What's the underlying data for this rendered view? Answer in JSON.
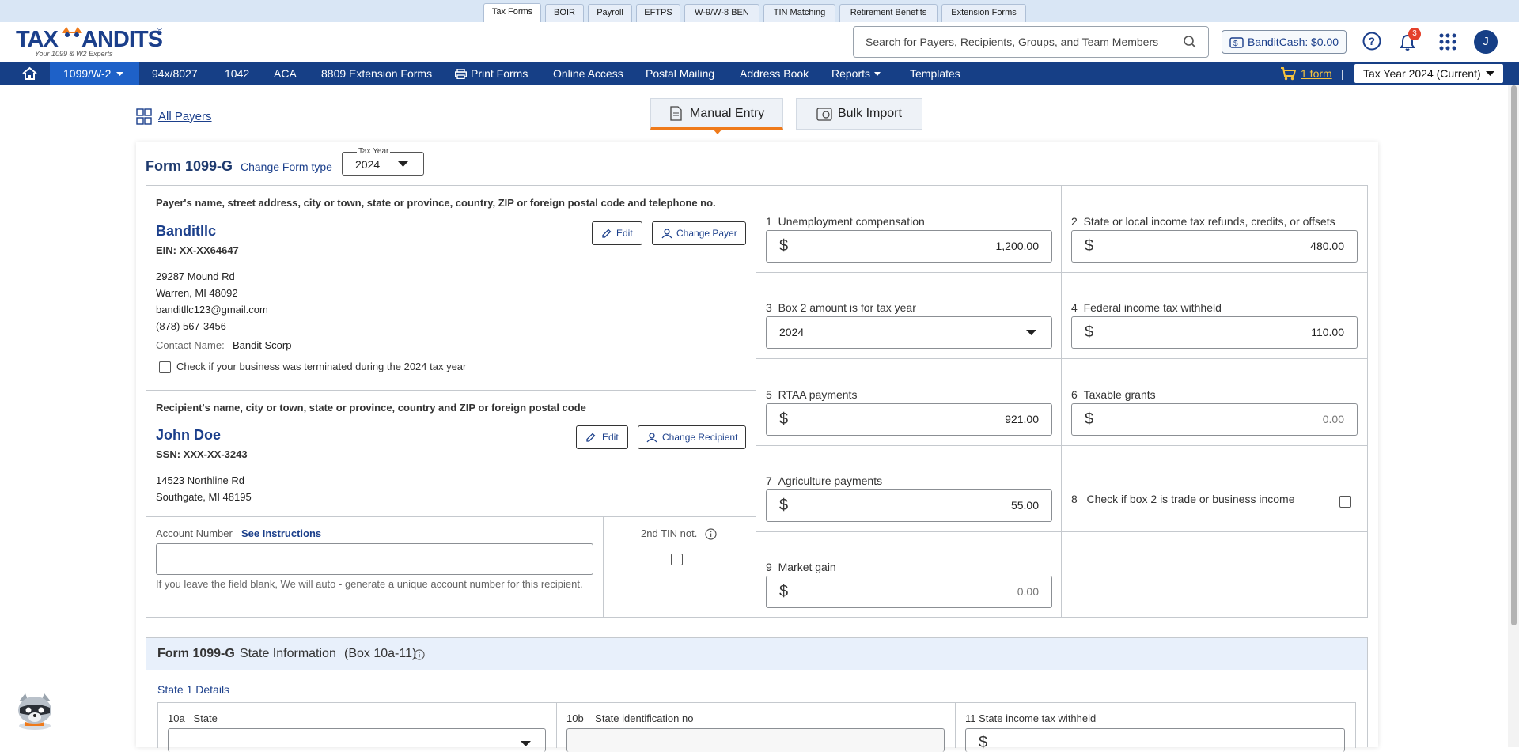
{
  "top_tabs": [
    "Tax Forms",
    "BOIR",
    "Payroll",
    "EFTPS",
    "W-9/W-8 BEN",
    "TIN Matching",
    "Retirement Benefits",
    "Extension Forms"
  ],
  "logo": {
    "main": "TAXBANDITS",
    "reg": "®",
    "tagline": "Your 1099 & W2 Experts"
  },
  "search": {
    "placeholder": "Search for Payers, Recipients, Groups, and Team Members"
  },
  "banditcash": {
    "label": "BanditCash:",
    "amount": "$0.00"
  },
  "notifications": {
    "count": "3"
  },
  "avatar": {
    "initial": "J"
  },
  "nav": {
    "items": [
      "1099/W-2",
      "94x/8027",
      "1042",
      "ACA",
      "8809 Extension Forms",
      "Print Forms",
      "Online Access",
      "Postal Mailing",
      "Address Book",
      "Reports",
      "Templates"
    ],
    "cart": "1 form",
    "divider": "|",
    "tax_year": "Tax Year 2024 (Current)"
  },
  "page": {
    "all_payers": "All Payers",
    "manual_entry": "Manual Entry",
    "bulk_import": "Bulk Import"
  },
  "form": {
    "title": "Form 1099-G",
    "change_type": "Change Form type",
    "tax_year_label": "Tax Year",
    "tax_year": "2024",
    "payer_heading": "Payer's name, street address, city or town, state or province, country, ZIP or foreign postal code and telephone no.",
    "payer": {
      "name": "Banditllc",
      "ein": "EIN: XX-XX64647",
      "street": "29287 Mound Rd",
      "city": "Warren, MI 48092",
      "email": "banditllc123@gmail.com",
      "phone": "(878) 567-3456",
      "contact_label": "Contact Name:",
      "contact": "Bandit Scorp",
      "terminated": "Check if your business was terminated during the 2024 tax year",
      "edit": "Edit",
      "change": "Change Payer"
    },
    "recipient_heading": "Recipient's name, city or town, state or province, country and ZIP or foreign postal code",
    "recipient": {
      "name": "John Doe",
      "ssn": "SSN: XXX-XX-3243",
      "street": "14523 Northline Rd",
      "city": "Southgate, MI 48195",
      "edit": "Edit",
      "change": "Change Recipient"
    },
    "account": {
      "label": "Account Number",
      "instructions": "See Instructions",
      "help": "If you leave the field blank, We will auto - generate a unique account number for this recipient.",
      "value": ""
    },
    "tin": {
      "label": "2nd TIN not."
    },
    "boxes": {
      "b1": {
        "num": "1",
        "label": "Unemployment compensation",
        "value": "1,200.00"
      },
      "b2": {
        "num": "2",
        "label": "State or local income tax refunds, credits, or offsets",
        "value": "480.00"
      },
      "b3": {
        "num": "3",
        "label": "Box 2 amount is for tax year",
        "value": "2024"
      },
      "b4": {
        "num": "4",
        "label": "Federal income tax withheld",
        "value": "110.00"
      },
      "b5": {
        "num": "5",
        "label": "RTAA payments",
        "value": "921.00"
      },
      "b6": {
        "num": "6",
        "label": "Taxable grants",
        "value": "0.00"
      },
      "b7": {
        "num": "7",
        "label": "Agriculture payments",
        "value": "55.00"
      },
      "b8": {
        "num": "8",
        "label": "Check if box 2 is trade or business income"
      },
      "b9": {
        "num": "9",
        "label": "Market gain",
        "value": "0.00"
      }
    },
    "currency": "$",
    "state_section": {
      "title_form": "Form 1099-G",
      "title_rest": "State Information",
      "title_boxes": "(Box 10a-11)",
      "details": "State 1 Details",
      "s10a_num": "10a",
      "s10a": "State",
      "s10b_num": "10b",
      "s10b": "State identification no",
      "s11": "11 State income tax withheld"
    }
  },
  "colors": {
    "nav": "#163f86",
    "nav_active": "#1e61c8",
    "accent": "#ef7a1a",
    "link": "#1b3f8b"
  }
}
